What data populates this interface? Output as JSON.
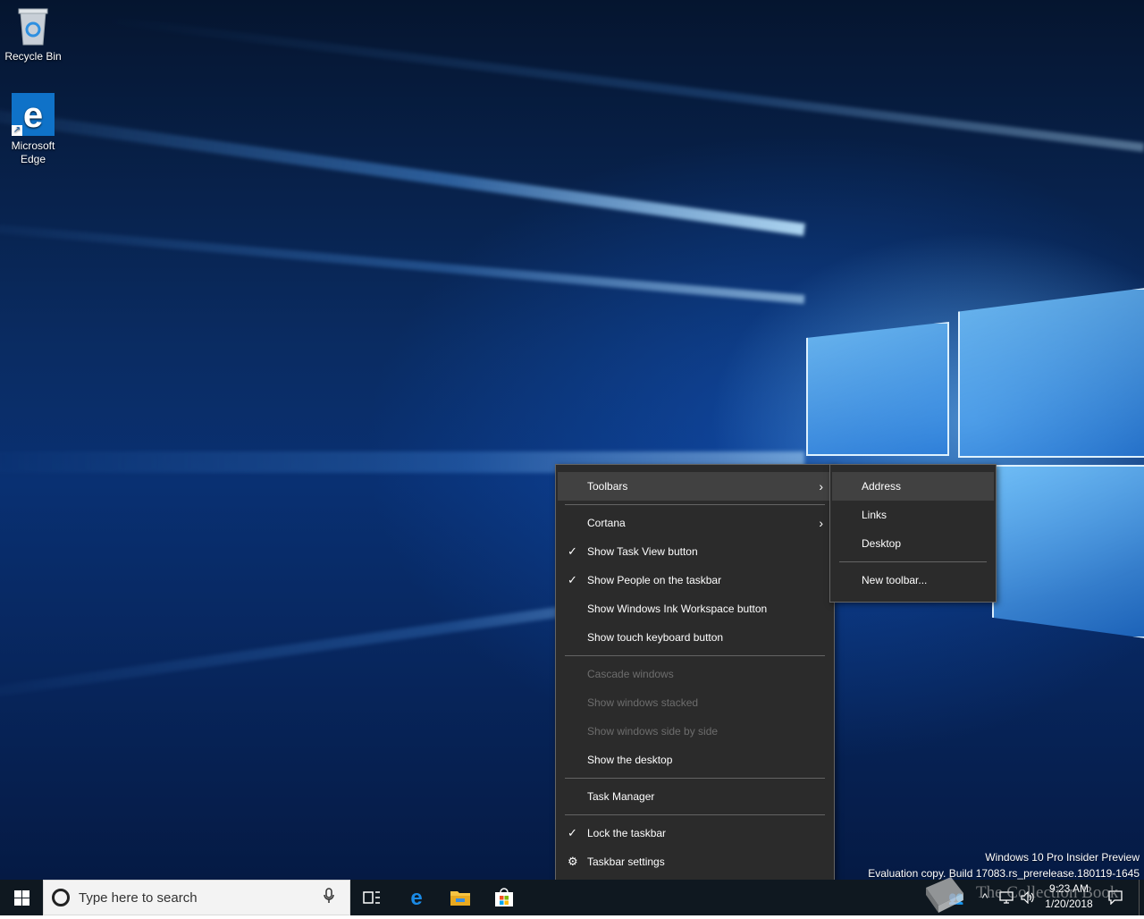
{
  "desktop": {
    "icons": [
      {
        "label": "Recycle Bin"
      },
      {
        "label": "Microsoft Edge"
      }
    ],
    "watermark": {
      "line1": "Windows 10 Pro Insider Preview",
      "line2": "Evaluation copy. Build 17083.rs_prerelease.180119-1645"
    }
  },
  "context_menu": {
    "items": [
      {
        "label": "Toolbars",
        "submenu": true,
        "highlighted": true
      },
      {
        "label": "Cortana",
        "submenu": true
      },
      {
        "label": "Show Task View button",
        "checked": true
      },
      {
        "label": "Show People on the taskbar",
        "checked": true
      },
      {
        "label": "Show Windows Ink Workspace button"
      },
      {
        "label": "Show touch keyboard button"
      },
      {
        "label": "Cascade windows",
        "disabled": true
      },
      {
        "label": "Show windows stacked",
        "disabled": true
      },
      {
        "label": "Show windows side by side",
        "disabled": true
      },
      {
        "label": "Show the desktop"
      },
      {
        "label": "Task Manager"
      },
      {
        "label": "Lock the taskbar",
        "checked": true
      },
      {
        "label": "Taskbar settings",
        "icon": "gear-icon"
      }
    ]
  },
  "toolbars_submenu": {
    "items": [
      {
        "label": "Address",
        "highlighted": true
      },
      {
        "label": "Links"
      },
      {
        "label": "Desktop"
      },
      {
        "label": "New toolbar..."
      }
    ]
  },
  "taskbar": {
    "search_placeholder": "Type here to search",
    "pinned": [
      "task-view-icon",
      "edge-icon",
      "file-explorer-icon",
      "store-icon"
    ],
    "clock": {
      "time": "9:23 AM",
      "date": "1/20/2018"
    },
    "brand_text": "The Collection Book"
  },
  "colors": {
    "menu_bg": "#2b2b2b",
    "menu_highlight": "#414141",
    "menu_disabled_text": "#6d6d6d",
    "taskbar_bg": "#0f1820",
    "accent": "#0078d7"
  }
}
